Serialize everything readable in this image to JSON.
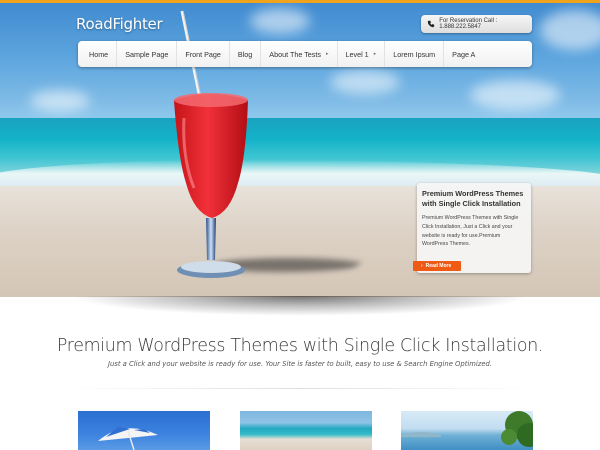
{
  "site": {
    "logo": "RoadFighter",
    "reservation": "For Reservation Call : 1.888.222.5847"
  },
  "nav": {
    "items": [
      {
        "label": "Home",
        "has_children": false
      },
      {
        "label": "Sample Page",
        "has_children": false
      },
      {
        "label": "Front Page",
        "has_children": false
      },
      {
        "label": "Blog",
        "has_children": false
      },
      {
        "label": "About The Tests",
        "has_children": true
      },
      {
        "label": "Level 1",
        "has_children": true
      },
      {
        "label": "Lorem Ipsum",
        "has_children": false
      },
      {
        "label": "Page A",
        "has_children": false
      }
    ]
  },
  "slide": {
    "title": "Premium WordPress Themes with Single Click Installation",
    "text": "Premium WordPress Themes with Single Click Installation, Just a Click and your website is ready for use.Premium WordPress Themes.",
    "button": "Read More"
  },
  "intro": {
    "heading": "Premium WordPress Themes with Single Click Installation.",
    "subheading": "Just a Click and your website is ready for use. Your Site is faster to built, easy to use & Search Engine Optimized."
  },
  "colors": {
    "accent_orange": "#ef5a14",
    "top_bar": "#f0a31b"
  },
  "icons": {
    "phone": "phone-icon",
    "read_more": "arrow-right-icon"
  }
}
